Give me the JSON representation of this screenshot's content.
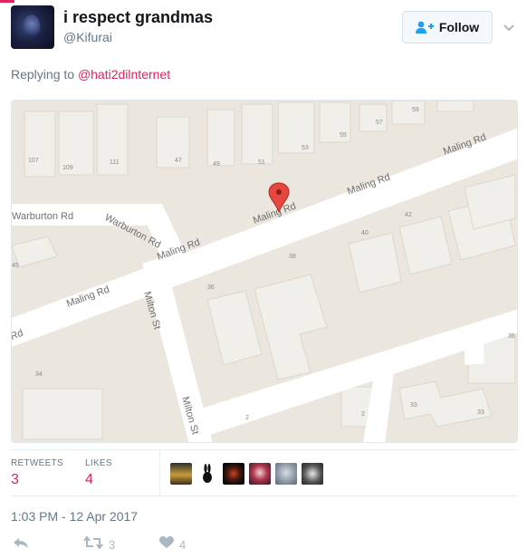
{
  "tweet": {
    "user_name": "i respect grandmas",
    "user_handle": "@Kifurai",
    "follow_label": "Follow",
    "replying_prefix": "Replying to",
    "replying_to": "@hati2dilnternet",
    "timestamp": "1:03 PM - 12 Apr 2017"
  },
  "map": {
    "street_labels": [
      "Maling Rd",
      "Maling Rd",
      "Maling Rd",
      "Maling Rd",
      "Maling Rd",
      "Warburton Rd",
      "Warburton Rd",
      "Milton St",
      "Milton St",
      "Rd"
    ],
    "house_numbers": [
      "107",
      "109",
      "111",
      "47",
      "49",
      "51",
      "53",
      "55",
      "57",
      "59",
      "40",
      "42",
      "38",
      "36",
      "45",
      "34",
      "2",
      "2",
      "33",
      "33",
      "35"
    ],
    "pin_color": "#e8473f"
  },
  "stats": {
    "retweets_label": "RETWEETS",
    "retweets_value": "3",
    "likes_label": "LIKES",
    "likes_value": "4"
  },
  "actions": {
    "retweet_count": "3",
    "like_count": "4"
  },
  "colors": {
    "accent": "#e0245e",
    "muted": "#657786",
    "border": "#e6ecf0"
  }
}
